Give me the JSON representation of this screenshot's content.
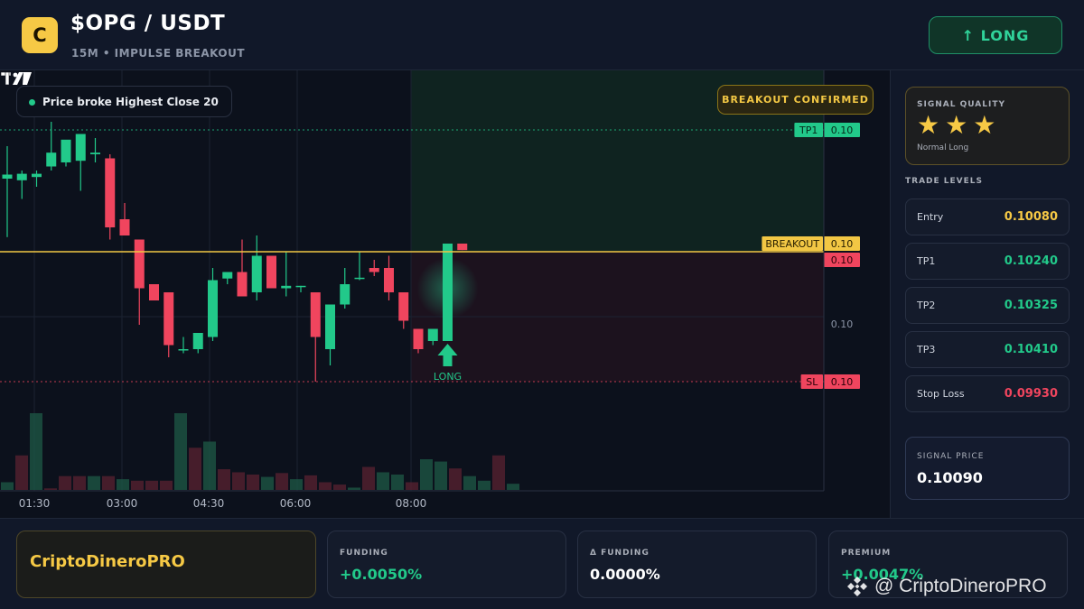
{
  "header": {
    "logo_letter": "C",
    "pair": "$OPG / USDT",
    "subtitle": "15M • IMPULSE BREAKOUT",
    "direction_button": "↑ LONG"
  },
  "chart": {
    "info_pill": "Price broke Highest Close 20",
    "status_badge": "BREAKOUT CONFIRMED",
    "signal_marker_label": "LONG",
    "price_tags": [
      {
        "label": "TP1",
        "value": "0.10"
      },
      {
        "label": "BREAKOUT",
        "value": "0.10"
      },
      {
        "label": "",
        "value": "0.10"
      },
      {
        "label": "",
        "value": "0.10"
      },
      {
        "label": "SL",
        "value": "0.10"
      }
    ],
    "time_labels": [
      "01:30",
      "03:00",
      "04:30",
      "06:00",
      "08:00"
    ],
    "colors": {
      "up": "#22c98a",
      "down": "#f0455e",
      "breakout": "#f2c744",
      "tp": "#22c98a",
      "sl": "#f0455e"
    }
  },
  "chart_data": {
    "type": "candlestick",
    "title": "",
    "xlabel": "",
    "ylabel": "",
    "interval": "15M",
    "x_ticks": [
      "01:30",
      "03:00",
      "04:30",
      "06:00",
      "08:00"
    ],
    "ylim": [
      0.0992,
      0.1026
    ],
    "levels": {
      "tp1": 0.1024,
      "breakout": 0.1009,
      "entry": 0.1008,
      "sl": 0.0993
    },
    "candles": [
      {
        "o": 0.1018,
        "h": 0.1022,
        "l": 0.10108,
        "c": 0.10185
      },
      {
        "o": 0.10178,
        "h": 0.1019,
        "l": 0.10155,
        "c": 0.10186
      },
      {
        "o": 0.10182,
        "h": 0.1019,
        "l": 0.1017,
        "c": 0.10186
      },
      {
        "o": 0.10195,
        "h": 0.1025,
        "l": 0.1019,
        "c": 0.10212
      },
      {
        "o": 0.102,
        "h": 0.10225,
        "l": 0.10195,
        "c": 0.10228
      },
      {
        "o": 0.10202,
        "h": 0.10235,
        "l": 0.10165,
        "c": 0.10235
      },
      {
        "o": 0.1021,
        "h": 0.1023,
        "l": 0.102,
        "c": 0.10212
      },
      {
        "o": 0.10205,
        "h": 0.1021,
        "l": 0.10105,
        "c": 0.1012
      },
      {
        "o": 0.1013,
        "h": 0.1015,
        "l": 0.1011,
        "c": 0.1011
      },
      {
        "o": 0.10105,
        "h": 0.10105,
        "l": 0.1,
        "c": 0.10045
      },
      {
        "o": 0.1005,
        "h": 0.1005,
        "l": 0.1003,
        "c": 0.1003
      },
      {
        "o": 0.1004,
        "h": 0.1004,
        "l": 0.0996,
        "c": 0.09975
      },
      {
        "o": 0.0997,
        "h": 0.09985,
        "l": 0.09965,
        "c": 0.0997
      },
      {
        "o": 0.0997,
        "h": 0.0999,
        "l": 0.09965,
        "c": 0.0999
      },
      {
        "o": 0.09985,
        "h": 0.1007,
        "l": 0.0998,
        "c": 0.10055
      },
      {
        "o": 0.10057,
        "h": 0.10065,
        "l": 0.1005,
        "c": 0.10065
      },
      {
        "o": 0.10065,
        "h": 0.10105,
        "l": 0.10035,
        "c": 0.10035
      },
      {
        "o": 0.1004,
        "h": 0.1011,
        "l": 0.1003,
        "c": 0.10085
      },
      {
        "o": 0.10085,
        "h": 0.10085,
        "l": 0.10045,
        "c": 0.10045
      },
      {
        "o": 0.10045,
        "h": 0.1009,
        "l": 0.10035,
        "c": 0.10048
      },
      {
        "o": 0.10048,
        "h": 0.10048,
        "l": 0.1004,
        "c": 0.10048
      },
      {
        "o": 0.1004,
        "h": 0.1004,
        "l": 0.0993,
        "c": 0.09985
      },
      {
        "o": 0.0997,
        "h": 0.10025,
        "l": 0.0995,
        "c": 0.10025
      },
      {
        "o": 0.10025,
        "h": 0.1007,
        "l": 0.1002,
        "c": 0.1005
      },
      {
        "o": 0.10058,
        "h": 0.1009,
        "l": 0.10055,
        "c": 0.10058
      },
      {
        "o": 0.1007,
        "h": 0.1008,
        "l": 0.1006,
        "c": 0.10065
      },
      {
        "o": 0.1007,
        "h": 0.10085,
        "l": 0.1003,
        "c": 0.1004
      },
      {
        "o": 0.1004,
        "h": 0.1004,
        "l": 0.09995,
        "c": 0.10005
      },
      {
        "o": 0.09995,
        "h": 0.09995,
        "l": 0.09965,
        "c": 0.0997
      },
      {
        "o": 0.0998,
        "h": 0.09995,
        "l": 0.09975,
        "c": 0.09995
      },
      {
        "o": 0.0998,
        "h": 0.101,
        "l": 0.0998,
        "c": 0.101
      },
      {
        "o": 0.101,
        "h": 0.101,
        "l": 0.10092,
        "c": 0.10092
      }
    ],
    "volume_scale": [
      0,
      100
    ],
    "volumes": [
      10,
      45,
      100,
      2,
      18,
      18,
      18,
      18,
      14,
      12,
      12,
      12,
      100,
      55,
      63,
      27,
      23,
      20,
      17,
      22,
      14,
      19,
      10,
      7,
      3,
      30,
      23,
      20,
      10,
      40,
      37,
      28,
      18,
      12,
      45,
      8
    ]
  },
  "signal_quality": {
    "label": "SIGNAL QUALITY",
    "stars": 3,
    "star_glyph": "★",
    "caption": "Normal Long"
  },
  "trade_levels": {
    "title": "TRADE LEVELS",
    "items": [
      {
        "name": "Entry",
        "value": "0.10080",
        "color": "#f6c945"
      },
      {
        "name": "TP1",
        "value": "0.10240",
        "color": "#22c98a"
      },
      {
        "name": "TP2",
        "value": "0.10325",
        "color": "#22c98a"
      },
      {
        "name": "TP3",
        "value": "0.10410",
        "color": "#22c98a"
      },
      {
        "name": "Stop Loss",
        "value": "0.09930",
        "color": "#f0455e"
      }
    ]
  },
  "signal_price": {
    "label": "SIGNAL PRICE",
    "value": "0.10090"
  },
  "bottom": {
    "brand": "CriptoDineroPRO",
    "stats": [
      {
        "label": "FUNDING",
        "value": "+0.0050%",
        "color": "#22c98a"
      },
      {
        "label": "Δ FUNDING",
        "value": "0.0000%",
        "color": "#ffffff"
      },
      {
        "label": "PREMIUM",
        "value": "+0.0047%",
        "color": "#22c98a"
      }
    ],
    "watermark": "@ CriptoDineroPRO"
  }
}
